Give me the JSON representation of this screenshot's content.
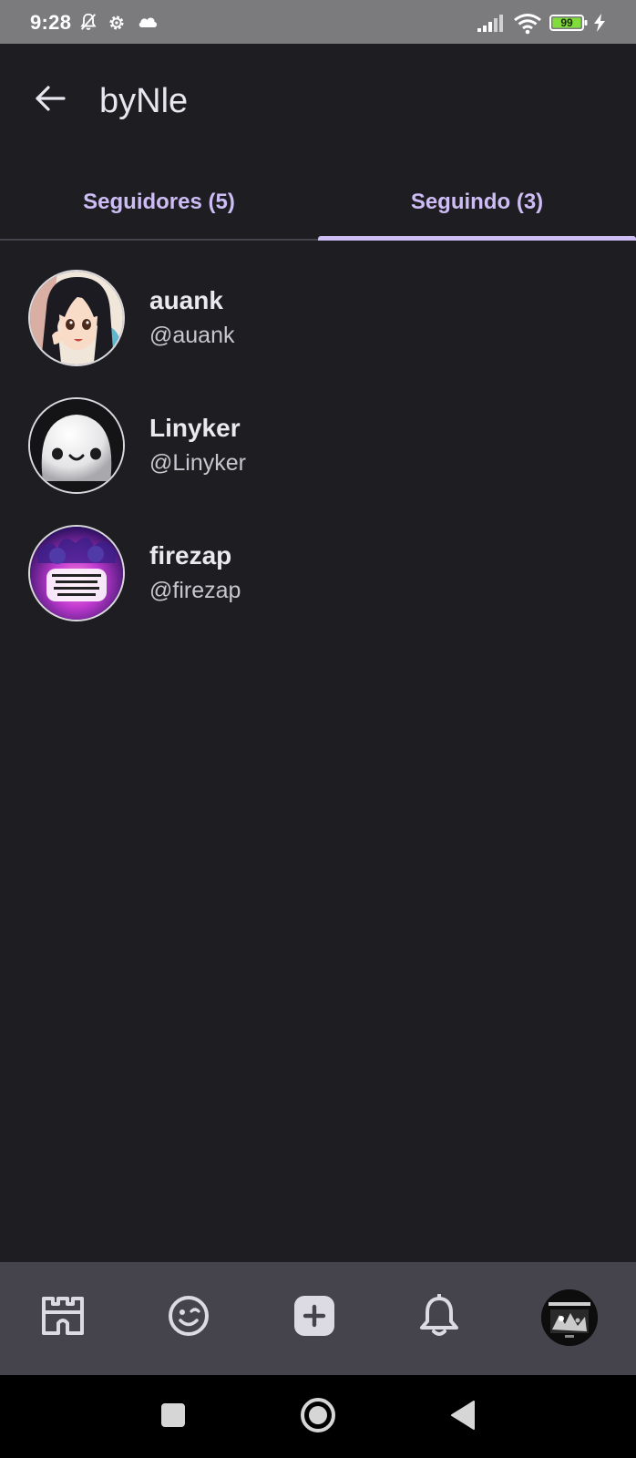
{
  "status_bar": {
    "time": "9:28",
    "battery_percent": "99",
    "icons": [
      "notifications-off-icon",
      "settings-gear-icon",
      "cloud-icon",
      "signal-icon",
      "wifi-icon",
      "battery-icon",
      "charging-bolt-icon"
    ],
    "battery_color": "#7fdc3a"
  },
  "header": {
    "title": "byNle",
    "back_icon": "arrow-back-icon"
  },
  "tabs": [
    {
      "label": "Seguidores (5)",
      "selected": false
    },
    {
      "label": "Seguindo (3)",
      "selected": true
    }
  ],
  "users": [
    {
      "name": "auank",
      "handle": "@auank",
      "avatar": "anime-girl-avatar"
    },
    {
      "name": "Linyker",
      "handle": "@Linyker",
      "avatar": "white-blob-face-avatar"
    },
    {
      "name": "firezap",
      "handle": "@firezap",
      "avatar": "purple-flames-meme-avatar"
    }
  ],
  "bottom_nav": {
    "items": [
      "castle-icon",
      "emoji-wink-icon",
      "add-post-icon",
      "bell-icon",
      "profile-avatar"
    ]
  },
  "system_nav": {
    "items": [
      "recents-square-icon",
      "home-circle-icon",
      "back-triangle-icon"
    ]
  },
  "colors": {
    "background": "#1e1d22",
    "accent": "#cdbdf4",
    "bottom_nav": "#45434c",
    "status_bar": "#7b7b7d"
  }
}
